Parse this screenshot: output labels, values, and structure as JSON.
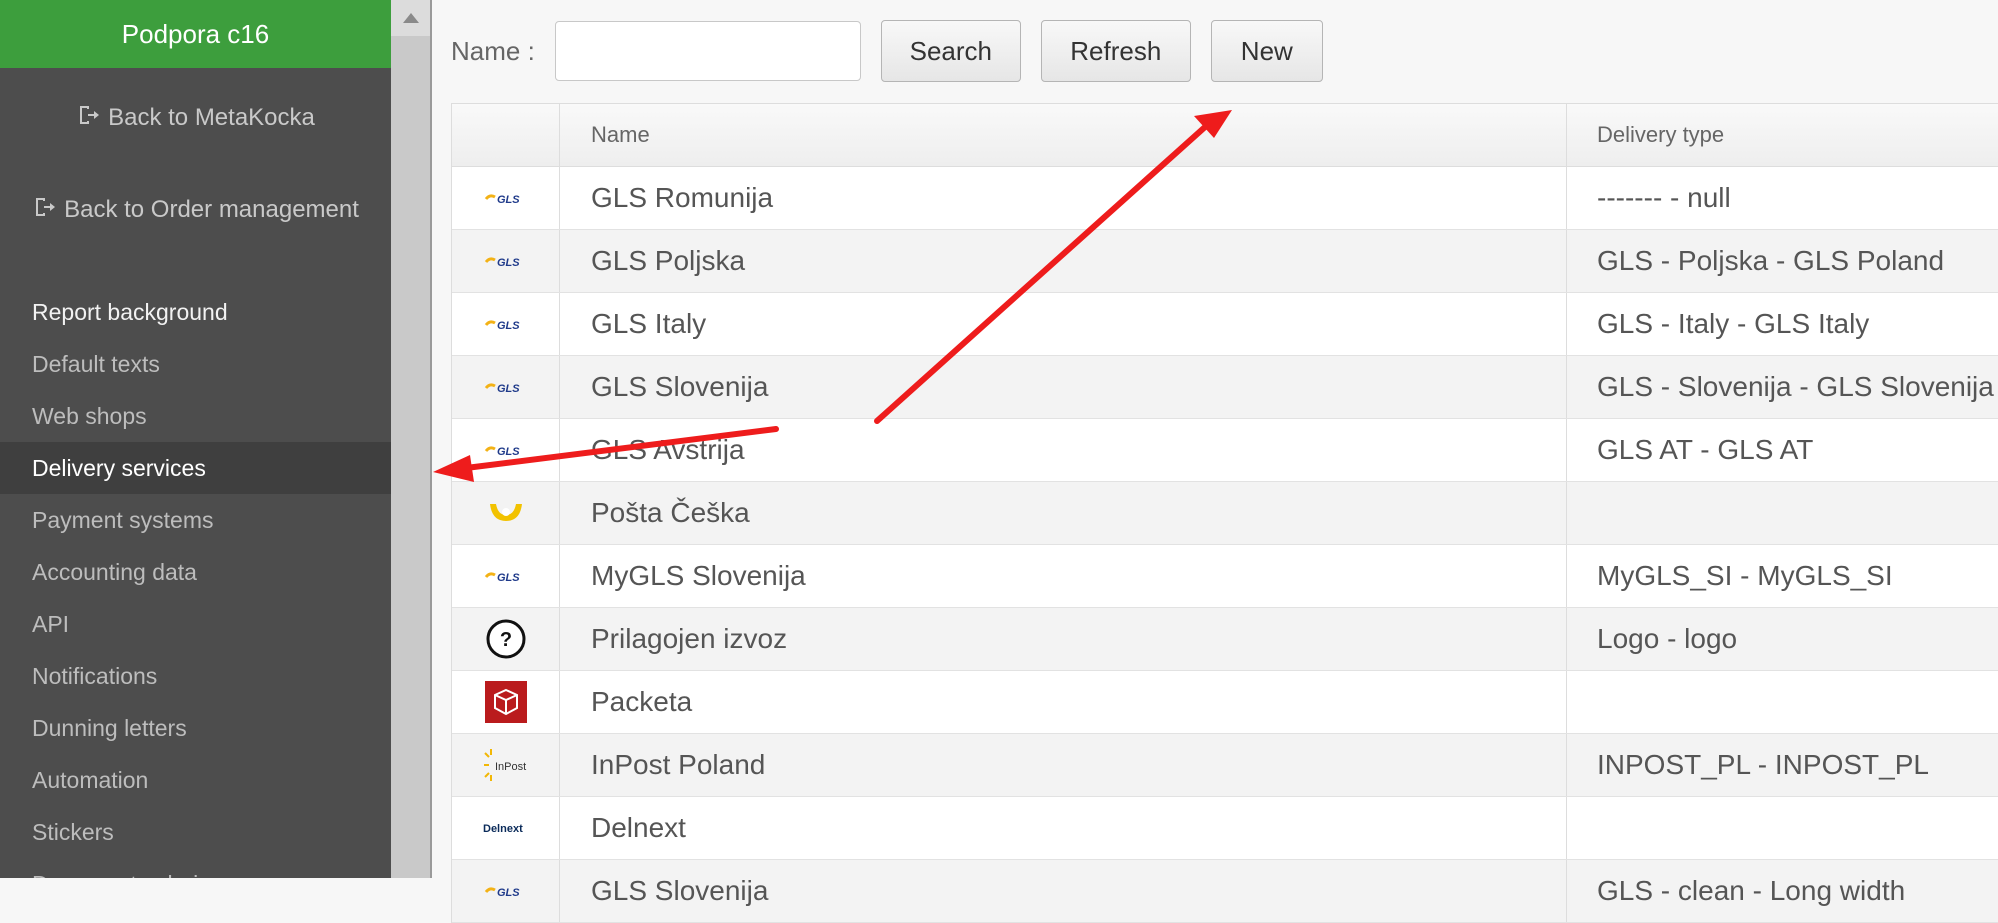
{
  "sidebar": {
    "title": "Podpora c16",
    "back_links": [
      "Back to MetaKocka",
      "Back to Order management"
    ],
    "items": [
      {
        "label": "Report background",
        "state": "bright"
      },
      {
        "label": "Default texts",
        "state": "normal"
      },
      {
        "label": "Web shops",
        "state": "normal"
      },
      {
        "label": "Delivery services",
        "state": "active"
      },
      {
        "label": "Payment systems",
        "state": "normal"
      },
      {
        "label": "Accounting data",
        "state": "normal"
      },
      {
        "label": "API",
        "state": "normal"
      },
      {
        "label": "Notifications",
        "state": "normal"
      },
      {
        "label": "Dunning letters",
        "state": "normal"
      },
      {
        "label": "Automation",
        "state": "normal"
      },
      {
        "label": "Stickers",
        "state": "normal"
      },
      {
        "label": "Document coloring",
        "state": "normal"
      }
    ]
  },
  "toolbar": {
    "name_label": "Name :",
    "name_value": "",
    "search_label": "Search",
    "refresh_label": "Refresh",
    "new_label": "New"
  },
  "table": {
    "columns": [
      "",
      "Name",
      "Delivery type"
    ],
    "rows": [
      {
        "icon": "gls-logo-icon",
        "name": "GLS Romunija",
        "type": "------- - null"
      },
      {
        "icon": "gls-logo-icon",
        "name": "GLS Poljska",
        "type": "GLS - Poljska - GLS Poland"
      },
      {
        "icon": "gls-logo-icon",
        "name": "GLS Italy",
        "type": "GLS - Italy - GLS Italy"
      },
      {
        "icon": "gls-logo-icon",
        "name": "GLS Slovenija",
        "type": "GLS - Slovenija - GLS Slovenija"
      },
      {
        "icon": "gls-logo-icon",
        "name": "GLS Avstrija",
        "type": "GLS AT - GLS AT"
      },
      {
        "icon": "posta-ceska-logo-icon",
        "name": "Pošta Češka",
        "type": ""
      },
      {
        "icon": "gls-logo-icon",
        "name": "MyGLS Slovenija",
        "type": "MyGLS_SI - MyGLS_SI"
      },
      {
        "icon": "question-mark-icon",
        "name": "Prilagojen izvoz",
        "type": "Logo - logo"
      },
      {
        "icon": "packeta-logo-icon",
        "name": "Packeta",
        "type": ""
      },
      {
        "icon": "inpost-logo-icon",
        "name": "InPost Poland",
        "type": "INPOST_PL - INPOST_PL"
      },
      {
        "icon": "delnext-logo-icon",
        "name": "Delnext",
        "type": ""
      },
      {
        "icon": "gls-logo-icon",
        "name": "GLS Slovenija",
        "type": "GLS - clean - Long width"
      }
    ]
  },
  "colors": {
    "header_green": "#3d9e3d",
    "sidebar_bg": "#4d4d4d",
    "annotation_red": "#ee1c1c",
    "gls_yellow": "#f3b216",
    "gls_blue": "#1f3a8a"
  }
}
